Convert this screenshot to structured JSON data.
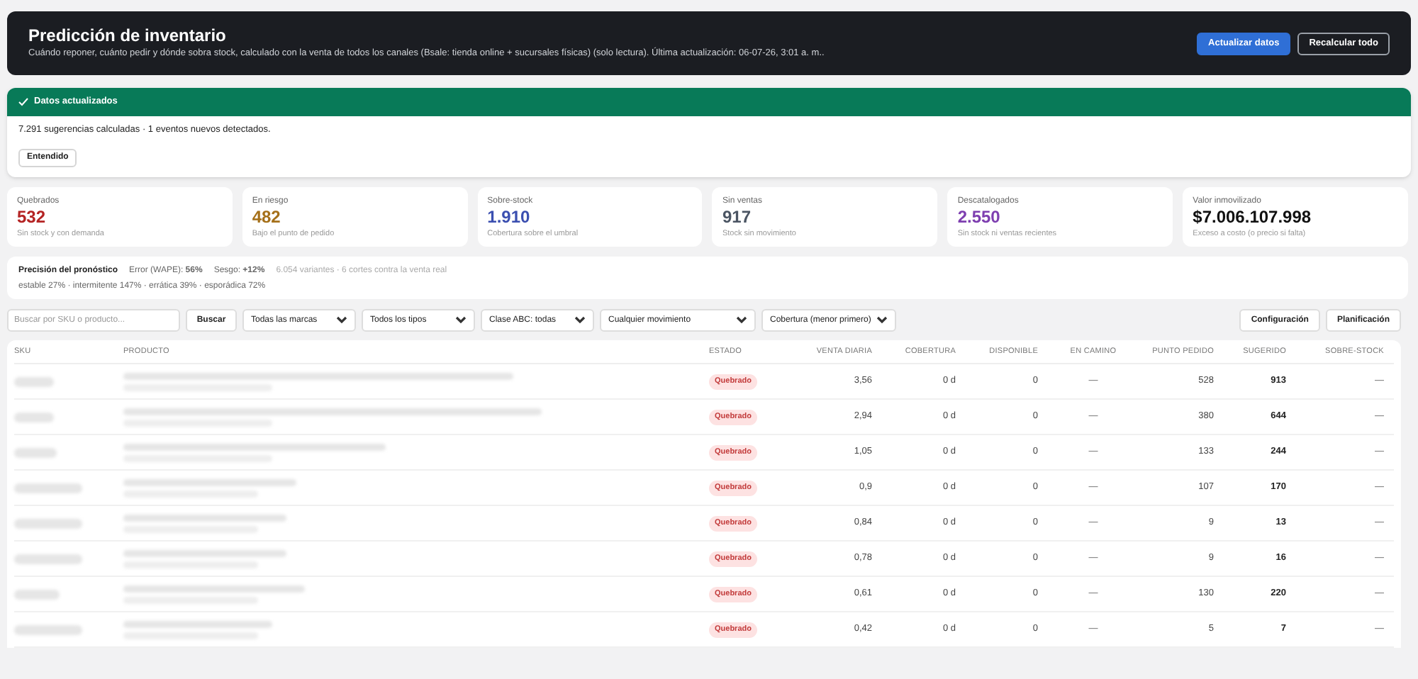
{
  "header": {
    "title": "Predicción de inventario",
    "subtitle": "Cuándo reponer, cuánto pedir y dónde sobra stock, calculado con la venta de todos los canales (Bsale: tienda online + sucursales físicas) (solo lectura). Última actualización: 06-07-26, 3:01 a. m..",
    "buttons": [
      {
        "label": "Actualizar datos",
        "kind": "primary"
      },
      {
        "label": "Recalcular todo",
        "kind": "outline"
      }
    ]
  },
  "alert": {
    "title": "Datos actualizados",
    "message": "7.291 sugerencias calculadas · 1 eventos nuevos detectados.",
    "button": "Entendido"
  },
  "stats": [
    {
      "label": "Quebrados",
      "value": "532",
      "note": "Sin stock y con demanda",
      "color": "#b42323"
    },
    {
      "label": "En riesgo",
      "value": "482",
      "note": "Bajo el punto de pedido",
      "color": "#a5701a"
    },
    {
      "label": "Sobre-stock",
      "value": "1.910",
      "note": "Cobertura sobre el umbral",
      "color": "#3b4fb0"
    },
    {
      "label": "Sin ventas",
      "value": "917",
      "note": "Stock sin movimiento",
      "color": "#4b5563"
    },
    {
      "label": "Descatalogados",
      "value": "2.550",
      "note": "Sin stock ni ventas recientes",
      "color": "#7e3fb0"
    },
    {
      "label": "Valor inmovilizado",
      "value": "$7.006.107.998",
      "note": "Exceso a costo (o precio si falta)",
      "color": "#111111"
    }
  ],
  "precision": {
    "title": "Precisión del pronóstico",
    "error": "Error (WAPE): **56%**",
    "bias": "Sesgo: **+12%**",
    "detail": "6.054 variantes · 6 cortes contra la venta real",
    "breakdown": "estable 27% · intermitente 147% · errática 39% · esporádica 72%"
  },
  "filters": {
    "search": {
      "placeholder": "Buscar por SKU o producto..."
    },
    "search_button": "Buscar",
    "selects": [
      "Todas las marcas",
      "Todos los tipos",
      "Clase ABC: todas",
      "Cualquier movimiento",
      "Cobertura (menor primero)"
    ],
    "actions": [
      "Configuración",
      "Planificación"
    ]
  },
  "table": {
    "columns": [
      "SKU",
      "PRODUCTO",
      "ESTADO",
      "VENTA DIARIA",
      "COBERTURA",
      "DISPONIBLE",
      "EN CAMINO",
      "PUNTO PEDIDO",
      "SUGERIDO",
      "SOBRE-STOCK"
    ],
    "rows": [
      {
        "status": "Quebrado",
        "daily": "3,56",
        "coverage": "0 d",
        "available": "0",
        "in_transit": "—",
        "reorder_point": "528",
        "suggested": "913",
        "overstock": "—"
      },
      {
        "status": "Quebrado",
        "daily": "2,94",
        "coverage": "0 d",
        "available": "0",
        "in_transit": "—",
        "reorder_point": "380",
        "suggested": "644",
        "overstock": "—"
      },
      {
        "status": "Quebrado",
        "daily": "1,05",
        "coverage": "0 d",
        "available": "0",
        "in_transit": "—",
        "reorder_point": "133",
        "suggested": "244",
        "overstock": "—"
      },
      {
        "status": "Quebrado",
        "daily": "0,9",
        "coverage": "0 d",
        "available": "0",
        "in_transit": "—",
        "reorder_point": "107",
        "suggested": "170",
        "overstock": "—"
      },
      {
        "status": "Quebrado",
        "daily": "0,84",
        "coverage": "0 d",
        "available": "0",
        "in_transit": "—",
        "reorder_point": "9",
        "suggested": "13",
        "overstock": "—"
      },
      {
        "status": "Quebrado",
        "daily": "0,78",
        "coverage": "0 d",
        "available": "0",
        "in_transit": "—",
        "reorder_point": "9",
        "suggested": "16",
        "overstock": "—"
      },
      {
        "status": "Quebrado",
        "daily": "0,61",
        "coverage": "0 d",
        "available": "0",
        "in_transit": "—",
        "reorder_point": "130",
        "suggested": "220",
        "overstock": "—"
      },
      {
        "status": "Quebrado",
        "daily": "0,42",
        "coverage": "0 d",
        "available": "0",
        "in_transit": "—",
        "reorder_point": "5",
        "suggested": "7",
        "overstock": "—"
      }
    ]
  }
}
